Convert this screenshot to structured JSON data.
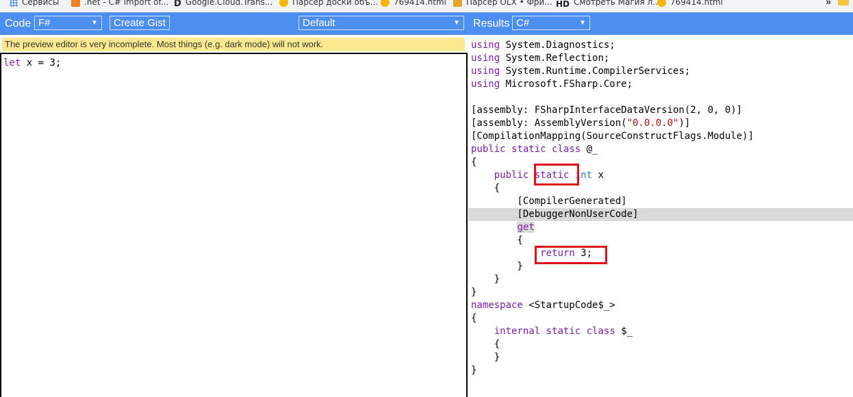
{
  "bookmarks": {
    "items": [
      {
        "icon": "apps-icon",
        "label": "Сервисы"
      },
      {
        "icon": "stackoverflow-icon",
        "label": ".net - C# import of..."
      },
      {
        "icon": "bookmark-b-icon",
        "label": "Google.Cloud.Trans..."
      },
      {
        "icon": "firefox-icon",
        "label": "Парсер доски объ..."
      },
      {
        "icon": "firefox-icon",
        "label": "769414.html"
      },
      {
        "icon": "olx-icon",
        "label": "Парсер OLX • Фри..."
      },
      {
        "icon": "hd-icon",
        "label": "Смотреть Магия л..."
      },
      {
        "icon": "firefox-icon",
        "label": "769414.html"
      }
    ],
    "more": "»"
  },
  "toolbar": {
    "code_label": "Code",
    "language_value": "F#",
    "create_gist_label": "Create Gist",
    "mode_value": "Default",
    "results_label": "Results",
    "output_lang_value": "C#"
  },
  "warning": "The preview editor is very incomplete. Most things (e.g. dark mode) will not work.",
  "editor": {
    "keyword": "let",
    "rest": " x = 3;"
  },
  "output_lines": [
    [
      [
        "kw",
        "using"
      ],
      [
        "",
        "System.Diagnostics;"
      ]
    ],
    [
      [
        "kw",
        "using"
      ],
      [
        "",
        "System.Reflection;"
      ]
    ],
    [
      [
        "kw",
        "using"
      ],
      [
        "",
        "System.Runtime.CompilerServices;"
      ]
    ],
    [
      [
        "kw",
        "using"
      ],
      [
        "",
        "Microsoft.FSharp.Core;"
      ]
    ],
    [],
    [
      [
        "",
        "[assembly: FSharpInterfaceDataVersion(2, 0, 0)]"
      ]
    ],
    [
      [
        "",
        "[assembly: AssemblyVersion("
      ],
      [
        "st",
        "\"0.0.0.0\""
      ],
      [
        "",
        ")]"
      ]
    ],
    [
      [
        "",
        "[CompilationMapping(SourceConstructFlags.Module)]"
      ]
    ],
    [
      [
        "kw",
        "public"
      ],
      [
        "kw",
        "static"
      ],
      [
        "kw",
        "class"
      ],
      [
        "",
        "@_"
      ]
    ],
    [
      [
        "",
        "{"
      ]
    ],
    [
      [
        "",
        "    "
      ],
      [
        "kw",
        "public"
      ],
      [
        "kw",
        "static"
      ],
      [
        "ty",
        "int"
      ],
      [
        "",
        "x"
      ]
    ],
    [
      [
        "",
        "    {"
      ]
    ],
    [
      [
        "",
        "        [CompilerGenerated]"
      ]
    ],
    [
      [
        "",
        "        [DebuggerNonUserCode]"
      ]
    ],
    [
      [
        "",
        "        "
      ],
      [
        "kw",
        "get"
      ]
    ],
    [
      [
        "",
        "        {"
      ]
    ],
    [
      [
        "",
        "            "
      ],
      [
        "kw",
        "return"
      ],
      [
        "",
        "3;"
      ]
    ],
    [
      [
        "",
        "        }"
      ]
    ],
    [
      [
        "",
        "    }"
      ]
    ],
    [
      [
        "",
        "}"
      ]
    ],
    [
      [
        "kw",
        "namespace"
      ],
      [
        "",
        "<StartupCode$_>"
      ]
    ],
    [
      [
        "",
        "{"
      ]
    ],
    [
      [
        "",
        "    "
      ],
      [
        "kw",
        "internal"
      ],
      [
        "kw",
        "static"
      ],
      [
        "kw",
        "class"
      ],
      [
        "",
        "$_"
      ]
    ],
    [
      [
        "",
        "    {"
      ]
    ],
    [
      [
        "",
        "    }"
      ]
    ],
    [
      [
        "",
        "}"
      ]
    ]
  ]
}
